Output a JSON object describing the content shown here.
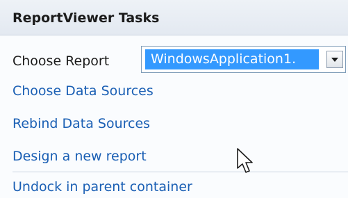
{
  "header": {
    "title": "ReportViewer Tasks"
  },
  "choose_report": {
    "label": "Choose Report",
    "selected_value": "WindowsApplication1."
  },
  "links": [
    {
      "label": "Choose Data Sources"
    },
    {
      "label": "Rebind Data Sources"
    },
    {
      "label": "Design a new report"
    },
    {
      "label": "Undock in parent container"
    }
  ],
  "icons": {
    "dropdown": "chevron-down-icon",
    "cursor": "mouse-pointer-icon"
  },
  "colors": {
    "link": "#1a5fb4",
    "selection": "#3399ff",
    "header_bg": "#e3e9f1"
  }
}
